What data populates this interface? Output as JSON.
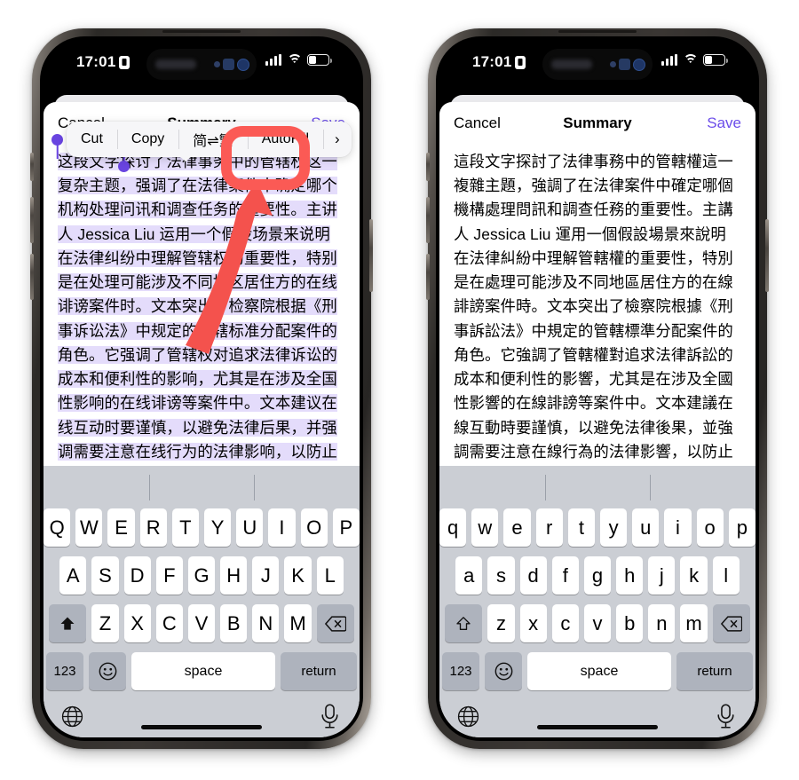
{
  "meta": {
    "scene": "Two iPhone screenshots side by side showing iOS text editing: left with Simplified Chinese text and the edit callout menu open (简⇌繁 highlighted), right showing the converted Traditional Chinese result.",
    "background_color": "#ffffff",
    "accent_color": "#6b4dea",
    "annotation_color": "#fb5a55",
    "selection_color": "#e4dcfb"
  },
  "status_bar": {
    "time": "17:01",
    "recording_badge": "screen-record-badge",
    "cellular_icon": "cellular-bars-icon",
    "wifi_icon": "wifi-icon",
    "battery_icon": "battery-icon"
  },
  "left_phone": {
    "nav": {
      "cancel_label": "Cancel",
      "title": "Summary",
      "save_label": "Save"
    },
    "edit_menu": {
      "items": [
        {
          "label": "Cut",
          "name": "cut"
        },
        {
          "label": "Copy",
          "name": "copy"
        },
        {
          "label": "简⇌繁",
          "name": "simplified-traditional-convert",
          "highlighted": true
        },
        {
          "label": "AutoFill",
          "name": "autofill"
        },
        {
          "label": "›",
          "name": "more-chevron"
        }
      ]
    },
    "document": {
      "selected": true,
      "text": "这段文字探讨了法律事务中的管辖权这一复杂主题，强调了在法律案件中确定哪个机构处理问讯和调查任务的重要性。主讲人 Jessica Liu 运用一个假设场景来说明在法律纠纷中理解管辖权的重要性，特别是在处理可能涉及不同地区居住方的在线诽谤案件时。文本突出了检察院根据《刑事诉讼法》中规定的管辖标准分配案件的角色。它强调了管辖权对追求法律诉讼的成本和便利性的影响，尤其是在涉及全国性影响的在线诽谤等案件中。文本建议在线互动时要谨慎，以避免法律后果，并强调需要注意在线行为的法律影响，以防止管辖挑战。最后，文本强调了做出明智决定以维护安全和尊重的在线环境的重要性，强调了在线诽谤和侮辱的严重后果。"
    }
  },
  "right_phone": {
    "nav": {
      "cancel_label": "Cancel",
      "title": "Summary",
      "save_label": "Save"
    },
    "document": {
      "selected": false,
      "text": "這段文字探討了法律事務中的管轄權這一複雜主題，強調了在法律案件中確定哪個機構處理問訊和調查任務的重要性。主講人 Jessica Liu 運用一個假設場景來說明在法律糾紛中理解管轄權的重要性，特別是在處理可能涉及不同地區居住方的在線誹謗案件時。文本突出了檢察院根據《刑事訴訟法》中規定的管轄標準分配案件的角色。它強調了管轄權對追求法律訴訟的成本和便利性的影響，尤其是在涉及全國性影響的在線誹謗等案件中。文本建議在線互動時要謹慎，以避免法律後果，並強調需要注意在線行為的法律影響，以防止管轄挑戰。最後，文本強調了做出明智決定以維護安全和尊重的在線環境的重要性，強調了在線誹謗和侮辱的嚴重後果。"
    }
  },
  "keyboard_left": {
    "case": "uppercase",
    "row1": [
      "Q",
      "W",
      "E",
      "R",
      "T",
      "Y",
      "U",
      "I",
      "O",
      "P"
    ],
    "row2": [
      "A",
      "S",
      "D",
      "F",
      "G",
      "H",
      "J",
      "K",
      "L"
    ],
    "row3": [
      "Z",
      "X",
      "C",
      "V",
      "B",
      "N",
      "M"
    ],
    "shift_icon": "shift-filled-icon",
    "backspace_icon": "backspace-icon",
    "numbers_label": "123",
    "emoji_icon": "emoji-smiley-icon",
    "space_label": "space",
    "return_label": "return",
    "globe_icon": "globe-icon",
    "mic_icon": "microphone-icon"
  },
  "keyboard_right": {
    "case": "lowercase",
    "row1": [
      "q",
      "w",
      "e",
      "r",
      "t",
      "y",
      "u",
      "i",
      "o",
      "p"
    ],
    "row2": [
      "a",
      "s",
      "d",
      "f",
      "g",
      "h",
      "j",
      "k",
      "l"
    ],
    "row3": [
      "z",
      "x",
      "c",
      "v",
      "b",
      "n",
      "m"
    ],
    "shift_icon": "shift-outline-icon",
    "backspace_icon": "backspace-icon",
    "numbers_label": "123",
    "emoji_icon": "emoji-smiley-icon",
    "space_label": "space",
    "return_label": "return",
    "globe_icon": "globe-icon",
    "mic_icon": "microphone-icon"
  }
}
